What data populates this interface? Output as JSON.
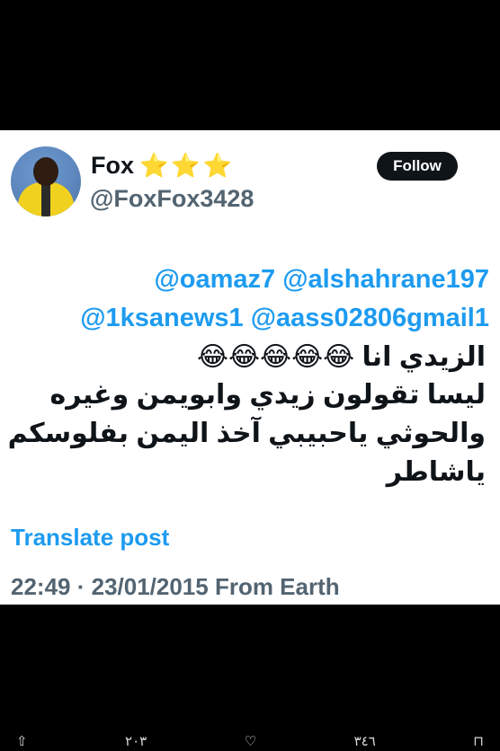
{
  "tweet": {
    "display_name": "Fox",
    "stars": [
      "⭐",
      "⭐",
      "⭐"
    ],
    "handle": "@FoxFox3428",
    "follow_label": "Follow",
    "mentions_line1": "@oamaz7 @alshahrane197",
    "mentions_line2": "@1ksanews1 @aass02806gmail1",
    "text_line1": "الزيدي انا 😂😂😂😂😂",
    "text_line2": "ليسا تقولون زيدي وابويمن وغيره",
    "text_line3": "والحوثي ياحبيبي آخذ اليمن بفلوسكم",
    "text_line4": "ياشاطر",
    "translate_label": "Translate post",
    "meta": "22:49 · 23/01/2015 From Earth"
  },
  "bottom_bar": {
    "share": "⇧",
    "views": "٢٠٣",
    "like": "♡",
    "reposts": "٣٤٦",
    "bookmark": "⊓"
  },
  "colors": {
    "link": "#1d9bf0",
    "secondary": "#536471",
    "text": "#0f1419",
    "background": "#000000"
  }
}
